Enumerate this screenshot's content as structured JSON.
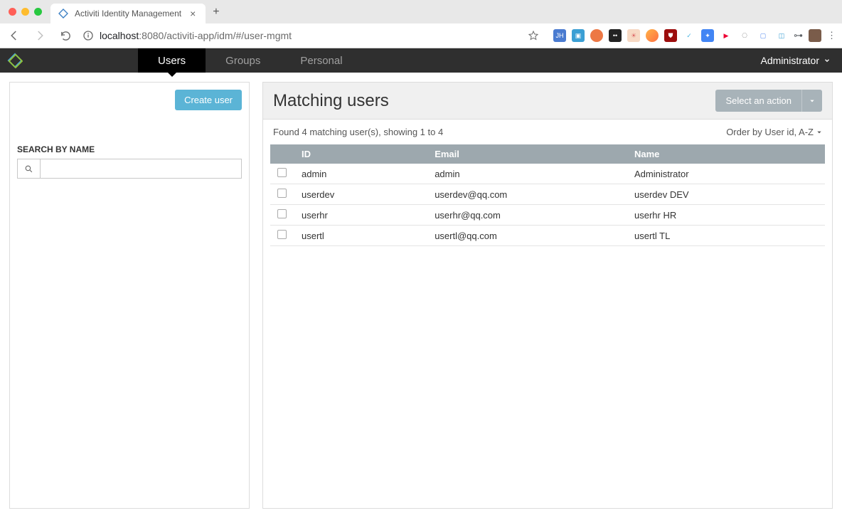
{
  "browser": {
    "tab_title": "Activiti Identity Management",
    "url_host": "localhost",
    "url_port": ":8080",
    "url_path": "/activiti-app/idm/#/user-mgmt"
  },
  "header": {
    "nav": [
      {
        "label": "Users",
        "active": true
      },
      {
        "label": "Groups",
        "active": false
      },
      {
        "label": "Personal",
        "active": false
      }
    ],
    "user": "Administrator"
  },
  "sidebar": {
    "create_label": "Create user",
    "search_label": "SEARCH BY NAME",
    "search_value": ""
  },
  "content": {
    "title": "Matching users",
    "action_label": "Select an action",
    "result_text": "Found 4 matching user(s), showing 1 to 4",
    "order_label": "Order by User id, A-Z",
    "columns": {
      "id": "ID",
      "email": "Email",
      "name": "Name"
    },
    "rows": [
      {
        "id": "admin",
        "email": "admin",
        "name": "Administrator"
      },
      {
        "id": "userdev",
        "email": "userdev@qq.com",
        "name": "userdev DEV"
      },
      {
        "id": "userhr",
        "email": "userhr@qq.com",
        "name": "userhr HR"
      },
      {
        "id": "usertl",
        "email": "usertl@qq.com",
        "name": "usertl TL"
      }
    ]
  }
}
